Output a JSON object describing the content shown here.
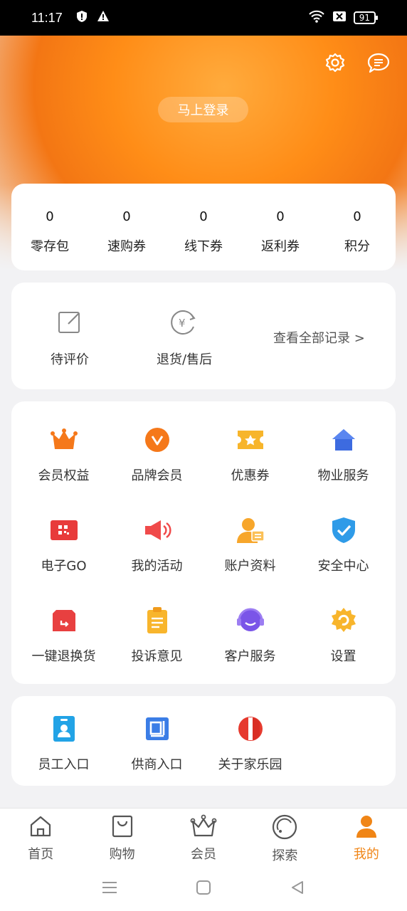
{
  "status_bar": {
    "time": "11:17",
    "battery": "91"
  },
  "header": {
    "login_label": "马上登录"
  },
  "stats": [
    {
      "value": "0",
      "label": "零存包"
    },
    {
      "value": "0",
      "label": "速购券"
    },
    {
      "value": "0",
      "label": "线下券"
    },
    {
      "value": "0",
      "label": "返利券"
    },
    {
      "value": "0",
      "label": "积分"
    }
  ],
  "orders": {
    "pending_review": "待评价",
    "returns": "退货/售后",
    "view_all": "查看全部记录 >"
  },
  "grid": [
    {
      "label": "会员权益",
      "icon": "crown-icon"
    },
    {
      "label": "品牌会员",
      "icon": "brand-vip-icon"
    },
    {
      "label": "优惠券",
      "icon": "coupon-icon"
    },
    {
      "label": "物业服务",
      "icon": "house-icon"
    },
    {
      "label": "电子GO",
      "icon": "qr-card-icon"
    },
    {
      "label": "我的活动",
      "icon": "megaphone-icon"
    },
    {
      "label": "账户资料",
      "icon": "account-profile-icon"
    },
    {
      "label": "安全中心",
      "icon": "shield-check-icon"
    },
    {
      "label": "一键退换货",
      "icon": "return-box-icon"
    },
    {
      "label": "投诉意见",
      "icon": "clipboard-icon"
    },
    {
      "label": "客户服务",
      "icon": "headset-icon"
    },
    {
      "label": "设置",
      "icon": "gear-icon"
    }
  ],
  "entries": [
    {
      "label": "员工入口",
      "icon": "employee-badge-icon"
    },
    {
      "label": "供商入口",
      "icon": "supplier-icon"
    },
    {
      "label": "关于家乐园",
      "icon": "about-logo-icon"
    }
  ],
  "bottom_nav": [
    {
      "label": "首页",
      "icon": "home-icon"
    },
    {
      "label": "购物",
      "icon": "shopping-bag-icon"
    },
    {
      "label": "会员",
      "icon": "crown-outline-icon"
    },
    {
      "label": "探索",
      "icon": "planet-icon"
    },
    {
      "label": "我的",
      "icon": "person-icon",
      "active": true
    }
  ],
  "colors": {
    "accent": "#f08516",
    "header": "#ff8d17"
  }
}
